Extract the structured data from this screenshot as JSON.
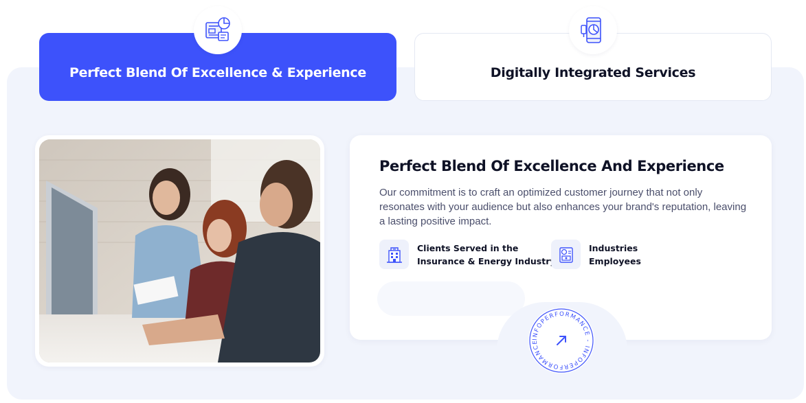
{
  "tabs": [
    {
      "label": "Perfect Blend Of Excellence & Experience",
      "icon": "presentation-chart-icon",
      "active": true
    },
    {
      "label": "Digitally Integrated Services",
      "icon": "mobile-analytics-icon",
      "active": false
    }
  ],
  "content": {
    "title": "Perfect Blend Of Excellence And Experience",
    "description": "Our commitment is to craft an optimized customer journey that not only resonates with your audience but also enhances your brand's reputation, leaving a lasting positive impact.",
    "stats": [
      {
        "icon": "building-icon",
        "line1": "Clients Served in the",
        "line2": "Insurance & Energy Industry"
      },
      {
        "icon": "employee-badge-icon",
        "line1": "Industries",
        "line2": "Employees"
      }
    ]
  },
  "badge": {
    "text": "INFOPERFORMANCE - INFOPERFORMANCE - ",
    "icon": "arrow-up-right-icon"
  },
  "colors": {
    "accent": "#3d52fb",
    "panel_bg": "#f1f4fc",
    "title": "#0f1226",
    "body_text": "#4a4e6b"
  }
}
